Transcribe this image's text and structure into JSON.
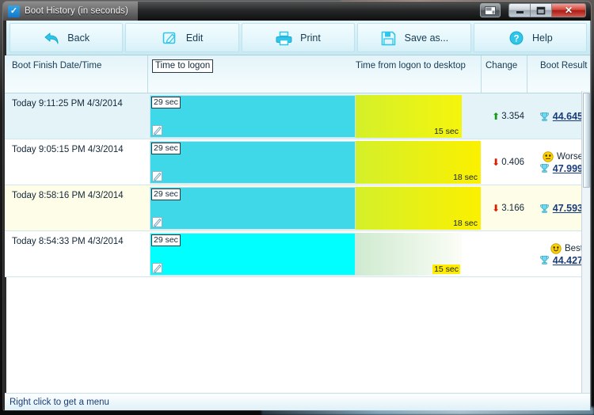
{
  "window": {
    "title": "Boot History (in seconds)",
    "app_icon": "checkmark-icon",
    "buttons": {
      "aero": "aero-peek",
      "minimize": "—",
      "maximize": "❐",
      "close": "✕"
    }
  },
  "toolbar": {
    "items": [
      {
        "label": "Back",
        "icon": "back-arrow-icon"
      },
      {
        "label": "Edit",
        "icon": "pencil-square-icon"
      },
      {
        "label": "Print",
        "icon": "printer-icon"
      },
      {
        "label": "Save as...",
        "icon": "floppy-disk-icon"
      },
      {
        "label": "Help",
        "icon": "question-circle-icon"
      }
    ]
  },
  "grid": {
    "headers": {
      "date": "Boot Finish Date/Time",
      "time_to_logon": "Time to logon",
      "logon_to_desktop": "Time from logon to desktop",
      "change": "Change",
      "boot_result": "Boot Result"
    },
    "rows": [
      {
        "date": "Today  9:11:25 PM 4/3/2014",
        "logon_label": "29 sec",
        "desktop_label": "15 sec",
        "change_value": "3.354",
        "change_dir": "up",
        "verdict": "",
        "verdict_face": "",
        "result": "44.645",
        "row_bg": "#e3f3f8",
        "cyan": "#3ed8e8",
        "yellow_from": "#d4f02a",
        "yellow_to": "#f5f50c",
        "cyan_w": 260,
        "yellow_w": 134
      },
      {
        "date": "Today  9:05:15 PM 4/3/2014",
        "logon_label": "29 sec",
        "desktop_label": "18 sec",
        "change_value": "0.406",
        "change_dir": "down",
        "verdict": "Worse",
        "verdict_face": "neutral-face-icon",
        "result": "47.999",
        "row_bg": "#ffffff",
        "cyan": "#3ed8e8",
        "yellow_from": "#d4f02a",
        "yellow_to": "#fbf000",
        "cyan_w": 260,
        "yellow_w": 158
      },
      {
        "date": "Today  8:58:16 PM 4/3/2014",
        "logon_label": "29 sec",
        "desktop_label": "18 sec",
        "change_value": "3.166",
        "change_dir": "down",
        "verdict": "",
        "verdict_face": "",
        "result": "47.593",
        "row_bg": "#fdfde8",
        "cyan": "#3ed8e8",
        "yellow_from": "#d4f02a",
        "yellow_to": "#fbf000",
        "cyan_w": 260,
        "yellow_w": 158
      },
      {
        "date": "Today  8:54:33 PM 4/3/2014",
        "logon_label": "29 sec",
        "desktop_label": "15 sec",
        "change_value": "",
        "change_dir": "none",
        "verdict": "Best",
        "verdict_face": "happy-face-icon",
        "result": "44.427",
        "row_bg": "#ffffff",
        "cyan": "#00ffff",
        "yellow_from": "#cfead0",
        "yellow_to": "#fbfdf6",
        "cyan_w": 260,
        "yellow_w": 134
      }
    ]
  },
  "statusbar": {
    "hint": "Right click to get a menu"
  }
}
